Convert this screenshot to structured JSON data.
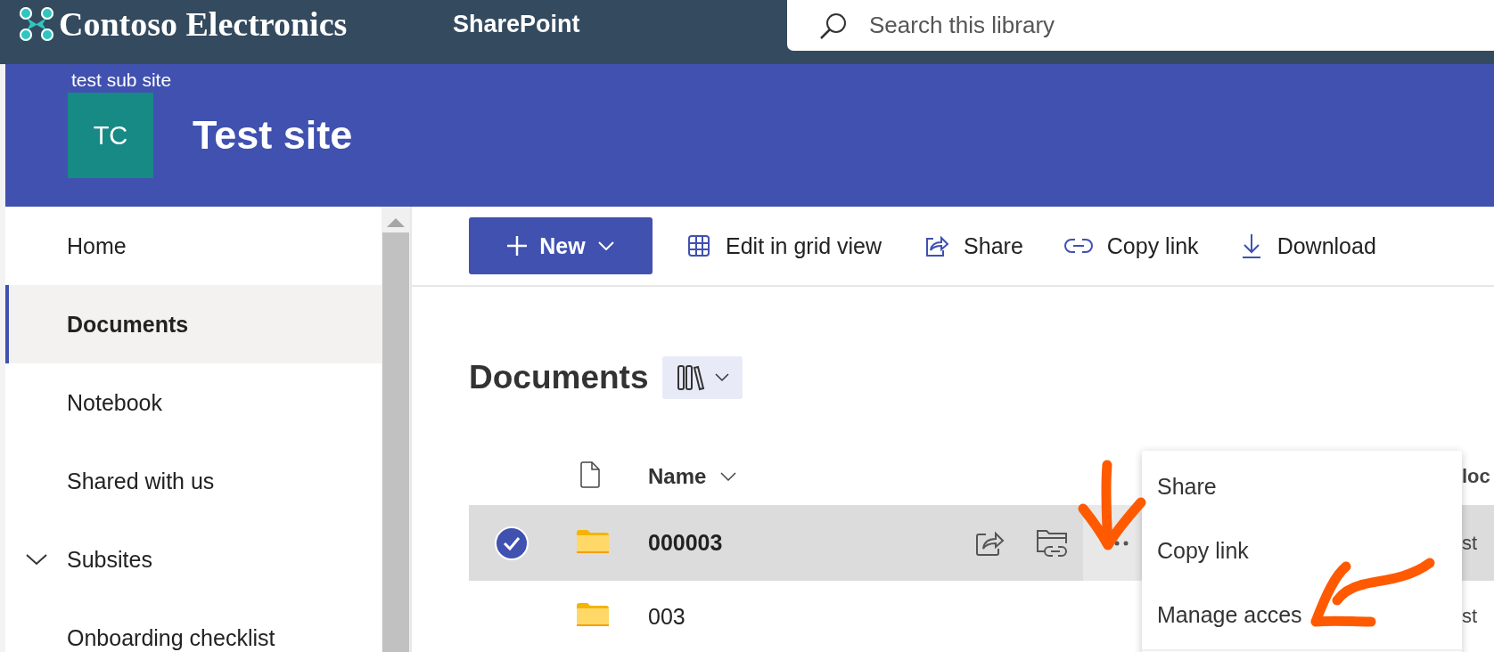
{
  "top_bar": {
    "logo_text": "Contoso Electronics",
    "app_name": "SharePoint",
    "search": {
      "placeholder": "Search this library"
    }
  },
  "site_header": {
    "parent_site": "test sub site",
    "initials": "TC",
    "title": "Test site"
  },
  "sidebar": {
    "items": [
      {
        "label": "Home",
        "selected": false
      },
      {
        "label": "Documents",
        "selected": true
      },
      {
        "label": "Notebook",
        "selected": false
      },
      {
        "label": "Shared with us",
        "selected": false
      },
      {
        "label": "Subsites",
        "selected": false,
        "expanded": true,
        "children": [
          {
            "label": "Onboarding checklist",
            "selected": false
          }
        ]
      }
    ]
  },
  "command_bar": {
    "new_button": "New",
    "actions": [
      {
        "label": "Edit in grid view",
        "kind": "grid"
      },
      {
        "label": "Share",
        "kind": "share"
      },
      {
        "label": "Copy link",
        "kind": "link"
      },
      {
        "label": "Download",
        "kind": "download"
      }
    ]
  },
  "library": {
    "title": "Documents",
    "columns": [
      "Name",
      "loc"
    ],
    "rows": [
      {
        "name": "000003",
        "selected": true,
        "column_2": "st"
      },
      {
        "name": "003",
        "selected": false,
        "column_2": "st"
      }
    ]
  },
  "context_menu": {
    "items": [
      "Share",
      "Copy link",
      "Manage acces"
    ]
  },
  "annotations": [
    {
      "kind": "arrow-down"
    },
    {
      "kind": "arrow-left"
    }
  ]
}
